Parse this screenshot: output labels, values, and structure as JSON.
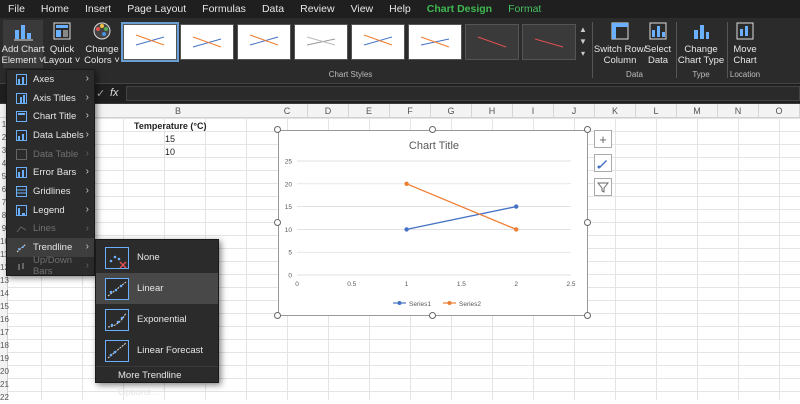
{
  "ribbon": {
    "tabs": [
      "File",
      "Home",
      "Insert",
      "Page Layout",
      "Formulas",
      "Data",
      "Review",
      "View",
      "Help",
      "Chart Design",
      "Format"
    ],
    "buttons": {
      "add_chart_element": "Add Chart\nElement ˅",
      "quick_layout": "Quick\nLayout ˅",
      "change_colors": "Change\nColors ˅",
      "switch_row_column": "Switch Row/\nColumn",
      "select_data": "Select\nData",
      "change_chart_type": "Change\nChart Type",
      "move_chart": "Move\nChart"
    },
    "groups": {
      "chart_styles": "Chart Styles",
      "data": "Data",
      "type": "Type",
      "location": "Location"
    }
  },
  "formula_bar": {
    "fx": "fx"
  },
  "columns": [
    "C",
    "D",
    "E",
    "F",
    "G",
    "H",
    "I",
    "J",
    "K",
    "L",
    "M",
    "N",
    "O"
  ],
  "col_b": "B",
  "rows": [
    "1",
    "2",
    "3",
    "4",
    "5",
    "6",
    "7",
    "8",
    "9",
    "10",
    "11",
    "12",
    "13",
    "14",
    "15",
    "16",
    "17",
    "18",
    "19",
    "20",
    "21",
    "22"
  ],
  "cells": {
    "header": "Temperature (°C)",
    "v1": "15",
    "v2": "10"
  },
  "chart": {
    "title": "Chart Title",
    "y_ticks": [
      "25",
      "20",
      "15",
      "10",
      "5",
      "0"
    ],
    "x_ticks": [
      "0",
      "0.5",
      "1",
      "1.5",
      "2",
      "2.5"
    ],
    "legend": [
      "Series1",
      "Series2"
    ]
  },
  "chart_data": {
    "type": "line",
    "title": "Chart Title",
    "xlim": [
      0,
      2.5
    ],
    "ylim": [
      0,
      25
    ],
    "grid": true,
    "legend_position": "bottom",
    "series": [
      {
        "name": "Series1",
        "x": [
          1,
          2
        ],
        "y": [
          10,
          15
        ],
        "color": "#4472c4"
      },
      {
        "name": "Series2",
        "x": [
          1,
          2
        ],
        "y": [
          20,
          10
        ],
        "color": "#ed7d31"
      }
    ]
  },
  "chart_element_menu": {
    "items": [
      {
        "label": "Axes",
        "enabled": true
      },
      {
        "label": "Axis Titles",
        "enabled": true
      },
      {
        "label": "Chart Title",
        "enabled": true
      },
      {
        "label": "Data Labels",
        "enabled": true
      },
      {
        "label": "Data Table",
        "enabled": false
      },
      {
        "label": "Error Bars",
        "enabled": true
      },
      {
        "label": "Gridlines",
        "enabled": true
      },
      {
        "label": "Legend",
        "enabled": true
      },
      {
        "label": "Lines",
        "enabled": false
      },
      {
        "label": "Trendline",
        "enabled": true
      },
      {
        "label": "Up/Down Bars",
        "enabled": false
      }
    ]
  },
  "trendline_menu": {
    "items": [
      {
        "label": "None"
      },
      {
        "label": "Linear"
      },
      {
        "label": "Exponential"
      },
      {
        "label": "Linear Forecast"
      }
    ],
    "more": "More Trendline Options..."
  },
  "colors": {
    "accent": "#3fb950",
    "series1": "#4472c4",
    "series2": "#ed7d31"
  }
}
